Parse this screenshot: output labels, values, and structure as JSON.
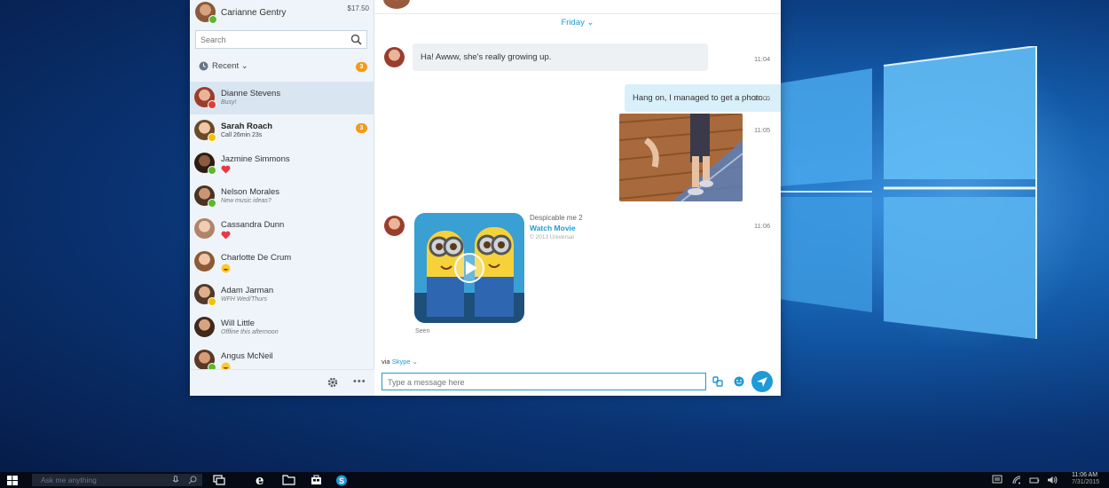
{
  "sidebar": {
    "profile": {
      "name": "Carianne Gentry",
      "credit": "$17.50"
    },
    "search": {
      "placeholder": "Search"
    },
    "recent": {
      "label": "Recent",
      "badge": "3"
    },
    "contacts": [
      {
        "name": "Dianne Stevens",
        "mood": "Busy!",
        "status": "busy"
      },
      {
        "name": "Sarah Roach",
        "mood": "Call 26min 23s",
        "badge": "3",
        "status": "away"
      },
      {
        "name": "Jazmine Simmons",
        "emoji": "heart",
        "status": "online"
      },
      {
        "name": "Nelson Morales",
        "mood": "New music ideas?",
        "status": "online"
      },
      {
        "name": "Cassandra Dunn",
        "emoji": "heart",
        "status": "none"
      },
      {
        "name": "Charlotte De Crum",
        "emoji": "laugh",
        "status": "none"
      },
      {
        "name": "Adam Jarman",
        "mood": "WFH Wed/Thurs",
        "status": "away"
      },
      {
        "name": "Will Little",
        "mood": "Offline this afternoon",
        "status": "none"
      },
      {
        "name": "Angus McNeil",
        "emoji": "laugh",
        "status": "online"
      }
    ]
  },
  "conversation": {
    "day": "Friday",
    "messages": [
      {
        "text": "Ha! Awww, she's really growing up.",
        "time": "11:04",
        "direction": "in"
      },
      {
        "text": "Hang on, I managed to get a photo...",
        "time": "11:05",
        "direction": "out"
      },
      {
        "type": "photo",
        "time": "11:05",
        "direction": "out"
      },
      {
        "type": "movie",
        "title": "Despicable me 2",
        "link": "Watch Movie",
        "copyright": "© 2013 Universal",
        "time": "11:06",
        "direction": "in"
      }
    ],
    "seen": "Seen",
    "via_label": "via",
    "via_service": "Skype",
    "compose_placeholder": "Type a message here"
  },
  "taskbar": {
    "search_placeholder": "Ask me anything",
    "time": "11:06 AM",
    "date": "7/31/2015"
  },
  "colors": {
    "accent": "#1e9ad6",
    "badge": "#f29a1b",
    "online": "#5cb82e",
    "busy": "#e53935",
    "away": "#f5c000"
  },
  "icons": [
    "search-icon",
    "clock-icon",
    "gear-icon",
    "more-icon",
    "attach-icon",
    "emoji-icon",
    "send-icon",
    "windows-start-icon",
    "microphone-icon",
    "task-view-icon",
    "edge-icon",
    "file-explorer-icon",
    "store-icon",
    "skype-icon",
    "action-center-icon",
    "wifi-icon",
    "battery-icon",
    "volume-icon",
    "play-icon"
  ]
}
